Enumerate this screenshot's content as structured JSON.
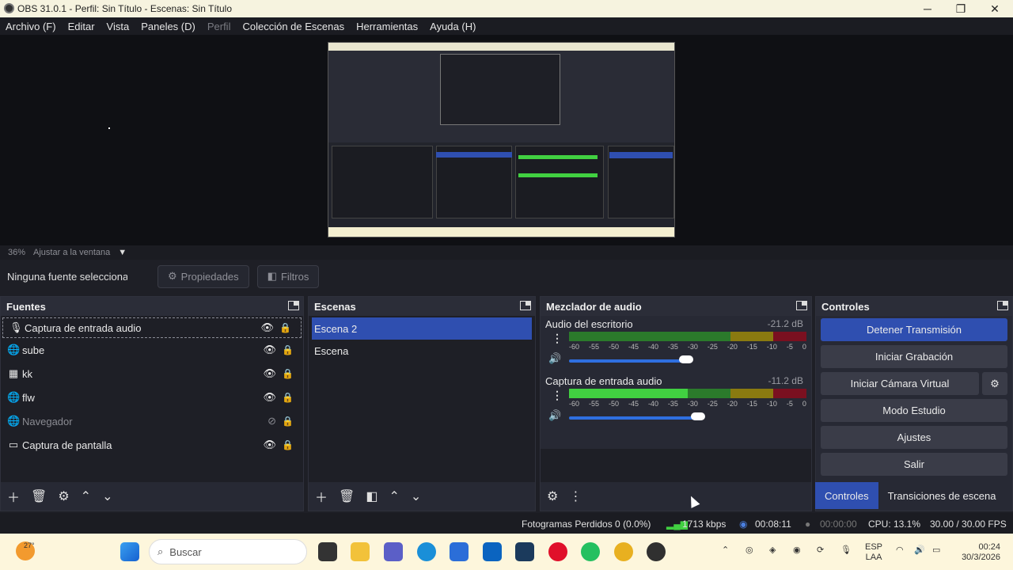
{
  "window": {
    "title": "OBS 31.0.1 - Perfil: Sin Título - Escenas: Sin Título"
  },
  "menu": {
    "items": [
      "Archivo (F)",
      "Editar",
      "Vista",
      "Paneles (D)",
      "Perfil",
      "Colección de Escenas",
      "Herramientas",
      "Ayuda (H)"
    ]
  },
  "preview": {
    "zoom": "36%",
    "fit_label": "Ajustar a la ventana"
  },
  "source_toolbar": {
    "no_source": "Ninguna fuente seleccionad",
    "properties": "Propiedades",
    "filters": "Filtros"
  },
  "sources": {
    "title": "Fuentes",
    "items": [
      {
        "label": "Captura de entrada audio",
        "icon": "microphone-icon",
        "visible": true,
        "selected": true
      },
      {
        "label": "sube",
        "icon": "globe-icon",
        "visible": true
      },
      {
        "label": "kk",
        "icon": "window-capture-icon",
        "visible": true
      },
      {
        "label": "flw",
        "icon": "globe-icon",
        "visible": true
      },
      {
        "label": "Navegador",
        "icon": "globe-icon",
        "visible": false
      },
      {
        "label": "Captura de pantalla",
        "icon": "monitor-icon",
        "visible": true
      }
    ]
  },
  "scenes": {
    "title": "Escenas",
    "items": [
      {
        "label": "Escena 2",
        "selected": true
      },
      {
        "label": "Escena"
      }
    ]
  },
  "mixer": {
    "title": "Mezclador de audio",
    "channels": [
      {
        "name": "Audio del escritorio",
        "db": "-21.2 dB",
        "volume": 0.78,
        "level": 0
      },
      {
        "name": "Captura de entrada audio",
        "db": "-11.2 dB",
        "volume": 0.86,
        "level": 0.5
      }
    ],
    "scale": [
      "-60",
      "-55",
      "-50",
      "-45",
      "-40",
      "-35",
      "-30",
      "-25",
      "-20",
      "-15",
      "-10",
      "-5",
      "0"
    ]
  },
  "controls": {
    "title": "Controles",
    "buttons": [
      "Detener Transmisión",
      "Iniciar Grabación",
      "Iniciar Cámara Virtual",
      "Modo Estudio",
      "Ajustes",
      "Salir"
    ]
  },
  "tabs": {
    "controls": "Controles",
    "transitions": "Transiciones de escena"
  },
  "status": {
    "dropped": "Fotogramas Perdidos 0 (0.0%)",
    "bitrate": "1713 kbps",
    "stream_time": "00:08:11",
    "rec_time": "00:00:00",
    "cpu": "CPU: 13.1%",
    "fps": "30.00 / 30.00 FPS"
  },
  "taskbar": {
    "temp": "27°",
    "search": "Buscar",
    "lang1": "ESP",
    "lang2": "LAA",
    "time": "00:24",
    "date": "30/3/2026"
  },
  "colors": {
    "accent": "#2f4fb0",
    "meter_green": "#41d041"
  }
}
